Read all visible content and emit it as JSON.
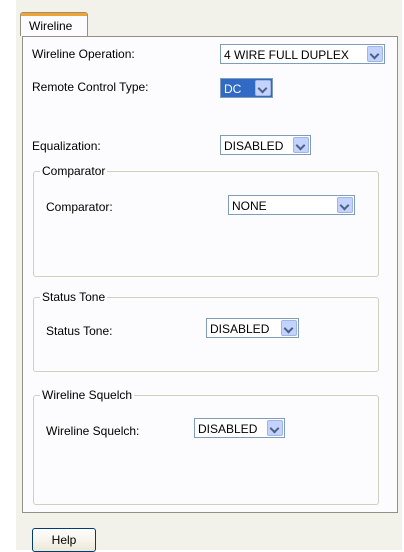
{
  "tab": {
    "label": "Wireline"
  },
  "wireline_operation": {
    "label": "Wireline Operation:",
    "value": "4 WIRE FULL DUPLEX"
  },
  "remote_control_type": {
    "label": "Remote Control Type:",
    "value": "DC"
  },
  "equalization": {
    "label": "Equalization:",
    "value": "DISABLED"
  },
  "comparator_group": {
    "title": "Comparator",
    "label": "Comparator:",
    "value": "NONE"
  },
  "status_tone_group": {
    "title": "Status Tone",
    "label": "Status Tone:",
    "value": "DISABLED"
  },
  "wireline_squelch_group": {
    "title": "Wireline Squelch",
    "label": "Wireline Squelch:",
    "value": "DISABLED"
  },
  "help_button": {
    "label": "Help"
  },
  "colors": {
    "tab_accent": "#f0a32f",
    "selection": "#316ac5",
    "dropdown_button": "#c3d3fd",
    "panel_bg": "#fcfcfe",
    "frame_bg": "#f2f1ea"
  }
}
